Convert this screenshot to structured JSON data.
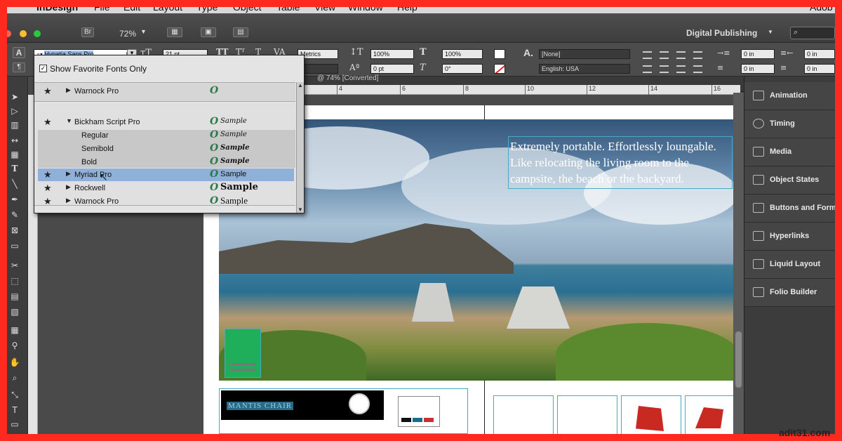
{
  "menu": [
    "InDesign",
    "File",
    "Edit",
    "Layout",
    "Type",
    "Object",
    "Table",
    "View",
    "Window",
    "Help"
  ],
  "menu_right": "Adob",
  "appbar": {
    "bridge": "Br",
    "zoom": "72%",
    "workspace": "Digital Publishing",
    "search_placeholder": ""
  },
  "control": {
    "font_name": "Hypatia Sans Pro",
    "font_size": "21 pt",
    "kerning": "Metrics",
    "vscale": "100%",
    "hscale": "100%",
    "baseline": "0 pt",
    "skew": "0°",
    "char_style": "[None]",
    "language": "English: USA",
    "indent_left": "0 in",
    "indent_right": "0 in",
    "indent_first": "0 in",
    "indent_last": "0 in",
    "leading_empty": "0"
  },
  "doc_tab": "@ 74% [Converted]",
  "ruler": [
    "4",
    "6",
    "8",
    "10",
    "12",
    "14",
    "16"
  ],
  "font_popup": {
    "show_favorites_label": "Show Favorite Fonts Only",
    "fonts": [
      {
        "name": "Warnock Pro",
        "sample": "",
        "type": "top"
      },
      {
        "name": "Bickham Script Pro",
        "sample": "Sample",
        "type": "open"
      },
      {
        "name": "Regular",
        "sample": "Sample",
        "type": "sub"
      },
      {
        "name": "Semibold",
        "sample": "Sample",
        "type": "sub"
      },
      {
        "name": "Bold",
        "sample": "Sample",
        "type": "sub"
      },
      {
        "name": "Myriad Pro",
        "sample": "Sample",
        "type": "selected"
      },
      {
        "name": "Rockwell",
        "sample": "Sample",
        "type": "fav"
      },
      {
        "name": "Warnock Pro",
        "sample": "Sample",
        "type": "fav"
      }
    ],
    "opentype_glyph": "O"
  },
  "page_text": {
    "headline": "Extremely portable. Effortlessly loungable. Like relocating the living room to the campsite, the beach or the backyard.",
    "chair_label": "MANTIS CHAIR"
  },
  "panels": [
    "Animation",
    "Timing",
    "Media",
    "Object States",
    "Buttons and Forms",
    "Hyperlinks",
    "Liquid Layout",
    "Folio Builder"
  ],
  "watermark": "adit31.com",
  "colors": {
    "accent_selected": "#8fb0d8",
    "frame_border": "#ff2a1f",
    "guide": "#4aa9c9"
  }
}
